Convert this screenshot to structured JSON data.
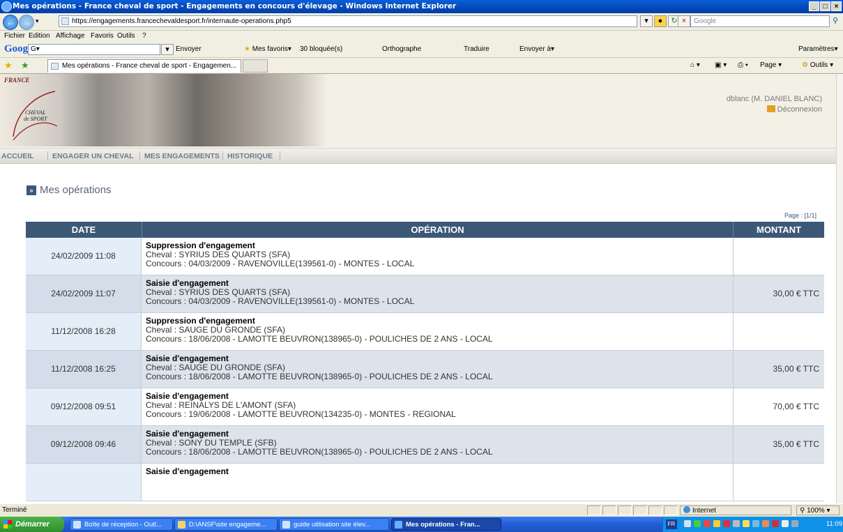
{
  "window": {
    "title": "Mes opérations - France cheval de sport - Engagements en concours d'élevage - Windows Internet Explorer",
    "buttons": [
      "_",
      "□",
      "×"
    ]
  },
  "address_bar": {
    "url": "https://engagements.francechevaldesport.fr/internaute-operations.php5",
    "search_placeholder": "Google"
  },
  "menu": [
    "Fichier",
    "Edition",
    "Affichage",
    "Favoris",
    "Outils",
    "?"
  ],
  "google_toolbar": {
    "logo": "Google",
    "select": "G▾",
    "items": {
      "send": "Envoyer",
      "favorites": "Mes favoris▾",
      "blocked": "30 bloquée(s)",
      "spelling": "Orthographe",
      "translate": "Traduire",
      "send_to": "Envoyer à▾",
      "settings": "Paramètres▾"
    }
  },
  "tabs": {
    "active": "Mes opérations - France cheval de sport - Engagemen...",
    "tools": {
      "page": "Page",
      "outils": "Outils"
    }
  },
  "site": {
    "logo_france": "FRANCE",
    "logo_cheval": "CHEVAL",
    "logo_sport": "de SPORT",
    "user": "dblanc (M. DANIEL BLANC)",
    "logout": "Déconnexion",
    "nav": [
      "ACCUEIL",
      "ENGAGER UN CHEVAL",
      "MES ENGAGEMENTS",
      "HISTORIQUE"
    ],
    "heading": "Mes opérations",
    "heading_marker": "»",
    "page_info": "Page : [1/1]"
  },
  "table": {
    "headers": [
      "DATE",
      "OPÉRATION",
      "MONTANT"
    ],
    "rows": [
      {
        "date": "24/02/2009 11:08",
        "op": "Suppression d'engagement",
        "cheval": "Cheval : SYRIUS DES QUARTS (SFA)",
        "concours": "Concours : 04/03/2009 - RAVENOVILLE(139561-0) - MONTES - LOCAL",
        "montant": ""
      },
      {
        "date": "24/02/2009 11:07",
        "op": "Saisie d'engagement",
        "cheval": "Cheval : SYRIUS DES QUARTS (SFA)",
        "concours": "Concours : 04/03/2009 - RAVENOVILLE(139561-0) - MONTES - LOCAL",
        "montant": "30,00 € TTC"
      },
      {
        "date": "11/12/2008 16:28",
        "op": "Suppression d'engagement",
        "cheval": "Cheval : SAUGE DU GRONDE (SFA)",
        "concours": "Concours : 18/06/2008 - LAMOTTE BEUVRON(138965-0) - POULICHES DE 2 ANS - LOCAL",
        "montant": ""
      },
      {
        "date": "11/12/2008 16:25",
        "op": "Saisie d'engagement",
        "cheval": "Cheval : SAUGE DU GRONDE (SFA)",
        "concours": "Concours : 18/06/2008 - LAMOTTE BEUVRON(138965-0) - POULICHES DE 2 ANS - LOCAL",
        "montant": "35,00 € TTC"
      },
      {
        "date": "09/12/2008 09:51",
        "op": "Saisie d'engagement",
        "cheval": "Cheval : REINALYS DE L'AMONT (SFA)",
        "concours": "Concours : 19/06/2008 - LAMOTTE BEUVRON(134235-0) - MONTES - REGIONAL",
        "montant": "70,00 € TTC"
      },
      {
        "date": "09/12/2008 09:46",
        "op": "Saisie d'engagement",
        "cheval": "Cheval : SONY DU TEMPLE (SFB)",
        "concours": "Concours : 18/06/2008 - LAMOTTE BEUVRON(138965-0) - POULICHES DE 2 ANS - LOCAL",
        "montant": "35,00 € TTC"
      },
      {
        "date": "",
        "op": "Saisie d'engagement",
        "cheval": "",
        "concours": "",
        "montant": ""
      }
    ]
  },
  "statusbar": {
    "text": "Terminé",
    "zone": "Internet",
    "zoom": "100%"
  },
  "taskbar": {
    "start": "Démarrer",
    "tasks": [
      "Boîte de réception - Outl...",
      "D:\\ANSF\\site engageme...",
      "guide utilisation site élev...",
      "Mes opérations - Fran..."
    ],
    "lang": "FR",
    "clock": "11:09"
  },
  "colors": {
    "table_header": "#3C5877",
    "row_even": "#DCE3EB",
    "title_bar": "#0448B8"
  }
}
